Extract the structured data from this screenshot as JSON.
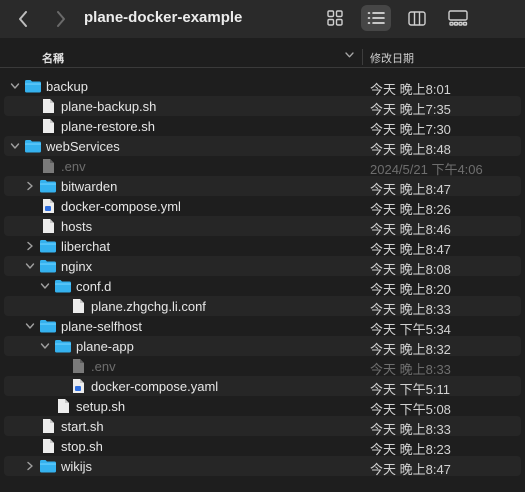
{
  "window": {
    "title": "plane-docker-example"
  },
  "toolbar": {
    "back": "chevron-left-icon",
    "forward": "chevron-right-icon",
    "views": [
      "icons-view-icon",
      "list-view-icon",
      "columns-view-icon",
      "gallery-view-icon"
    ],
    "active_view": "list"
  },
  "columns": {
    "name": "名稱",
    "date": "修改日期"
  },
  "colors": {
    "folder": "#35b2ef",
    "folder_tab": "#6cd0ff",
    "file": "#ededed",
    "dimmed": "#6e6e6e",
    "yaml_badge": "#2f6fe0"
  },
  "rows": [
    {
      "name": "backup",
      "date": "今天 晚上8:01",
      "level": 0,
      "kind": "folder",
      "expanded": true
    },
    {
      "name": "plane-backup.sh",
      "date": "今天 晚上7:35",
      "level": 1,
      "kind": "file"
    },
    {
      "name": "plane-restore.sh",
      "date": "今天 晚上7:30",
      "level": 1,
      "kind": "file"
    },
    {
      "name": "webServices",
      "date": "今天 晚上8:48",
      "level": 0,
      "kind": "folder",
      "expanded": true
    },
    {
      "name": ".env",
      "date": "2024/5/21 下午4:06",
      "level": 1,
      "kind": "hidden-file",
      "dim": true
    },
    {
      "name": "bitwarden",
      "date": "今天 晚上8:47",
      "level": 1,
      "kind": "folder",
      "expanded": false
    },
    {
      "name": "docker-compose.yml",
      "date": "今天 晚上8:26",
      "level": 1,
      "kind": "yaml"
    },
    {
      "name": "hosts",
      "date": "今天 晚上8:46",
      "level": 1,
      "kind": "file"
    },
    {
      "name": "liberchat",
      "date": "今天 晚上8:47",
      "level": 1,
      "kind": "folder",
      "expanded": false
    },
    {
      "name": "nginx",
      "date": "今天 晚上8:08",
      "level": 1,
      "kind": "folder",
      "expanded": true
    },
    {
      "name": "conf.d",
      "date": "今天 晚上8:20",
      "level": 2,
      "kind": "folder",
      "expanded": true
    },
    {
      "name": "plane.zhgchg.li.conf",
      "date": "今天 晚上8:33",
      "level": 3,
      "kind": "file"
    },
    {
      "name": "plane-selfhost",
      "date": "今天 下午5:34",
      "level": 1,
      "kind": "folder",
      "expanded": true
    },
    {
      "name": "plane-app",
      "date": "今天 晚上8:32",
      "level": 2,
      "kind": "folder",
      "expanded": true
    },
    {
      "name": ".env",
      "date": "今天 晚上8:33",
      "level": 3,
      "kind": "hidden-file",
      "dim": true
    },
    {
      "name": "docker-compose.yaml",
      "date": "今天 下午5:11",
      "level": 3,
      "kind": "yaml"
    },
    {
      "name": "setup.sh",
      "date": "今天 下午5:08",
      "level": 2,
      "kind": "file"
    },
    {
      "name": "start.sh",
      "date": "今天 晚上8:33",
      "level": 1,
      "kind": "file"
    },
    {
      "name": "stop.sh",
      "date": "今天 晚上8:23",
      "level": 1,
      "kind": "file"
    },
    {
      "name": "wikijs",
      "date": "今天 晚上8:47",
      "level": 1,
      "kind": "folder",
      "expanded": false
    }
  ]
}
